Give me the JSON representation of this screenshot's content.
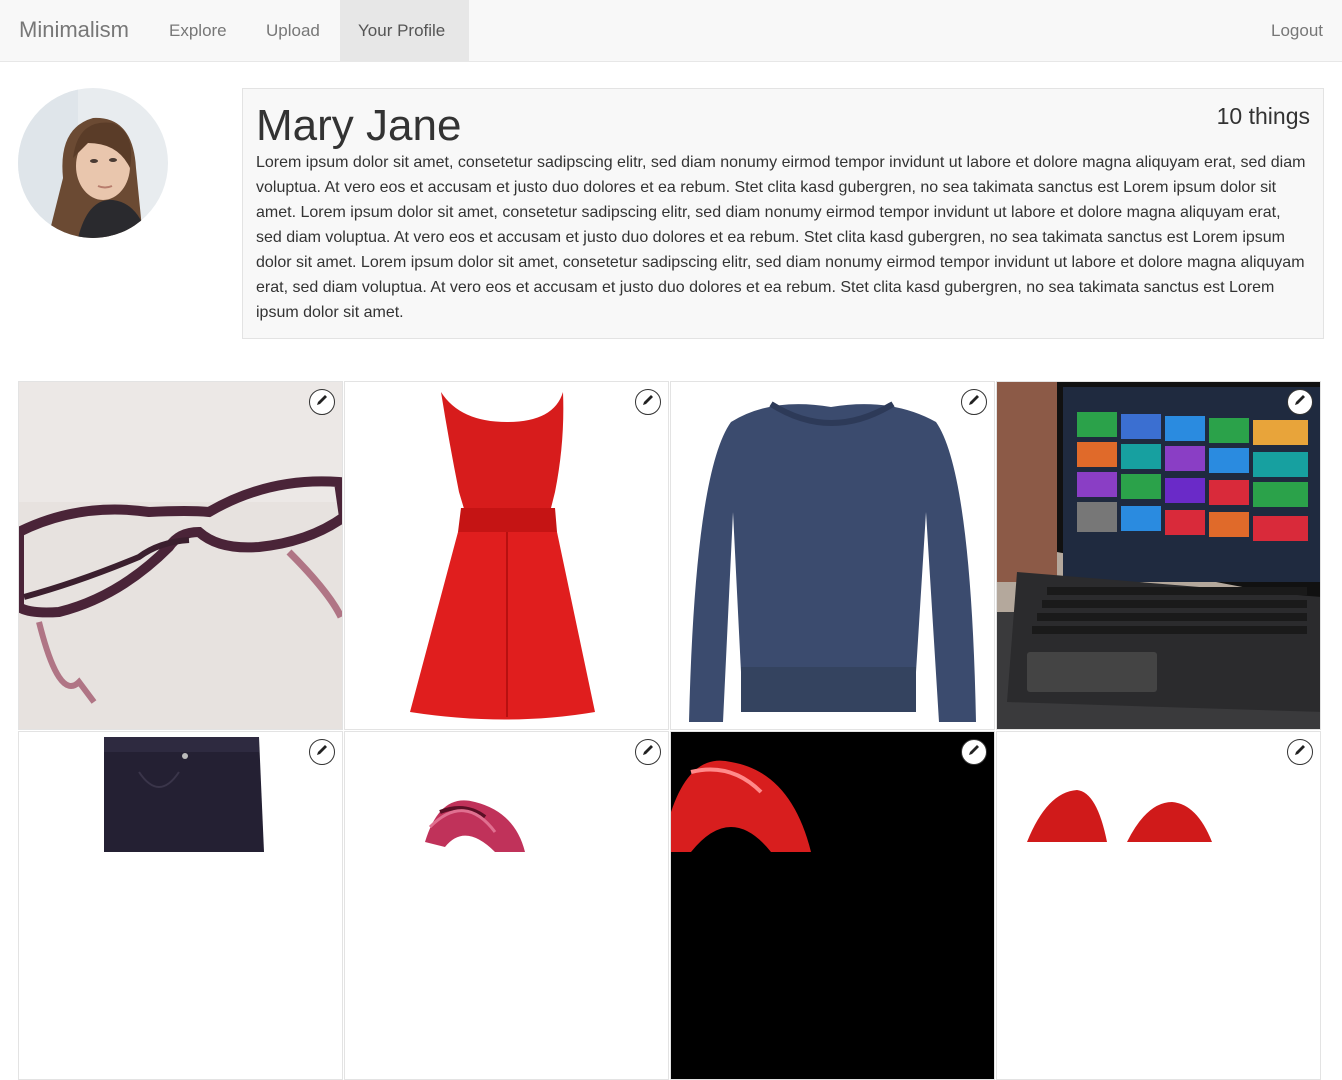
{
  "nav": {
    "brand": "Minimalism",
    "items": [
      {
        "label": "Explore"
      },
      {
        "label": "Upload"
      },
      {
        "label": "Your Profile"
      }
    ],
    "logout": "Logout"
  },
  "profile": {
    "name": "Mary Jane",
    "count": "10 things",
    "bio": "Lorem ipsum dolor sit amet, consetetur sadipscing elitr, sed diam nonumy eirmod tempor invidunt ut labore et dolore magna aliquyam erat, sed diam voluptua. At vero eos et accusam et justo duo dolores et ea rebum. Stet clita kasd gubergren, no sea takimata sanctus est Lorem ipsum dolor sit amet. Lorem ipsum dolor sit amet, consetetur sadipscing elitr, sed diam nonumy eirmod tempor invidunt ut labore et dolore magna aliquyam erat, sed diam voluptua. At vero eos et accusam et justo duo dolores et ea rebum. Stet clita kasd gubergren, no sea takimata sanctus est Lorem ipsum dolor sit amet. Lorem ipsum dolor sit amet, consetetur sadipscing elitr, sed diam nonumy eirmod tempor invidunt ut labore et dolore magna aliquyam erat, sed diam voluptua. At vero eos et accusam et justo duo dolores et ea rebum. Stet clita kasd gubergren, no sea takimata sanctus est Lorem ipsum dolor sit amet."
  },
  "things": [
    {
      "item": "glasses",
      "icon": "pencil-icon"
    },
    {
      "item": "red-dress",
      "icon": "pencil-icon"
    },
    {
      "item": "sweater",
      "icon": "pencil-icon"
    },
    {
      "item": "laptop",
      "icon": "pencil-icon"
    },
    {
      "item": "pants",
      "icon": "pencil-icon"
    },
    {
      "item": "shoes",
      "icon": "pencil-icon"
    },
    {
      "item": "red-heel",
      "icon": "pencil-icon"
    },
    {
      "item": "red-pumps",
      "icon": "pencil-icon"
    }
  ]
}
